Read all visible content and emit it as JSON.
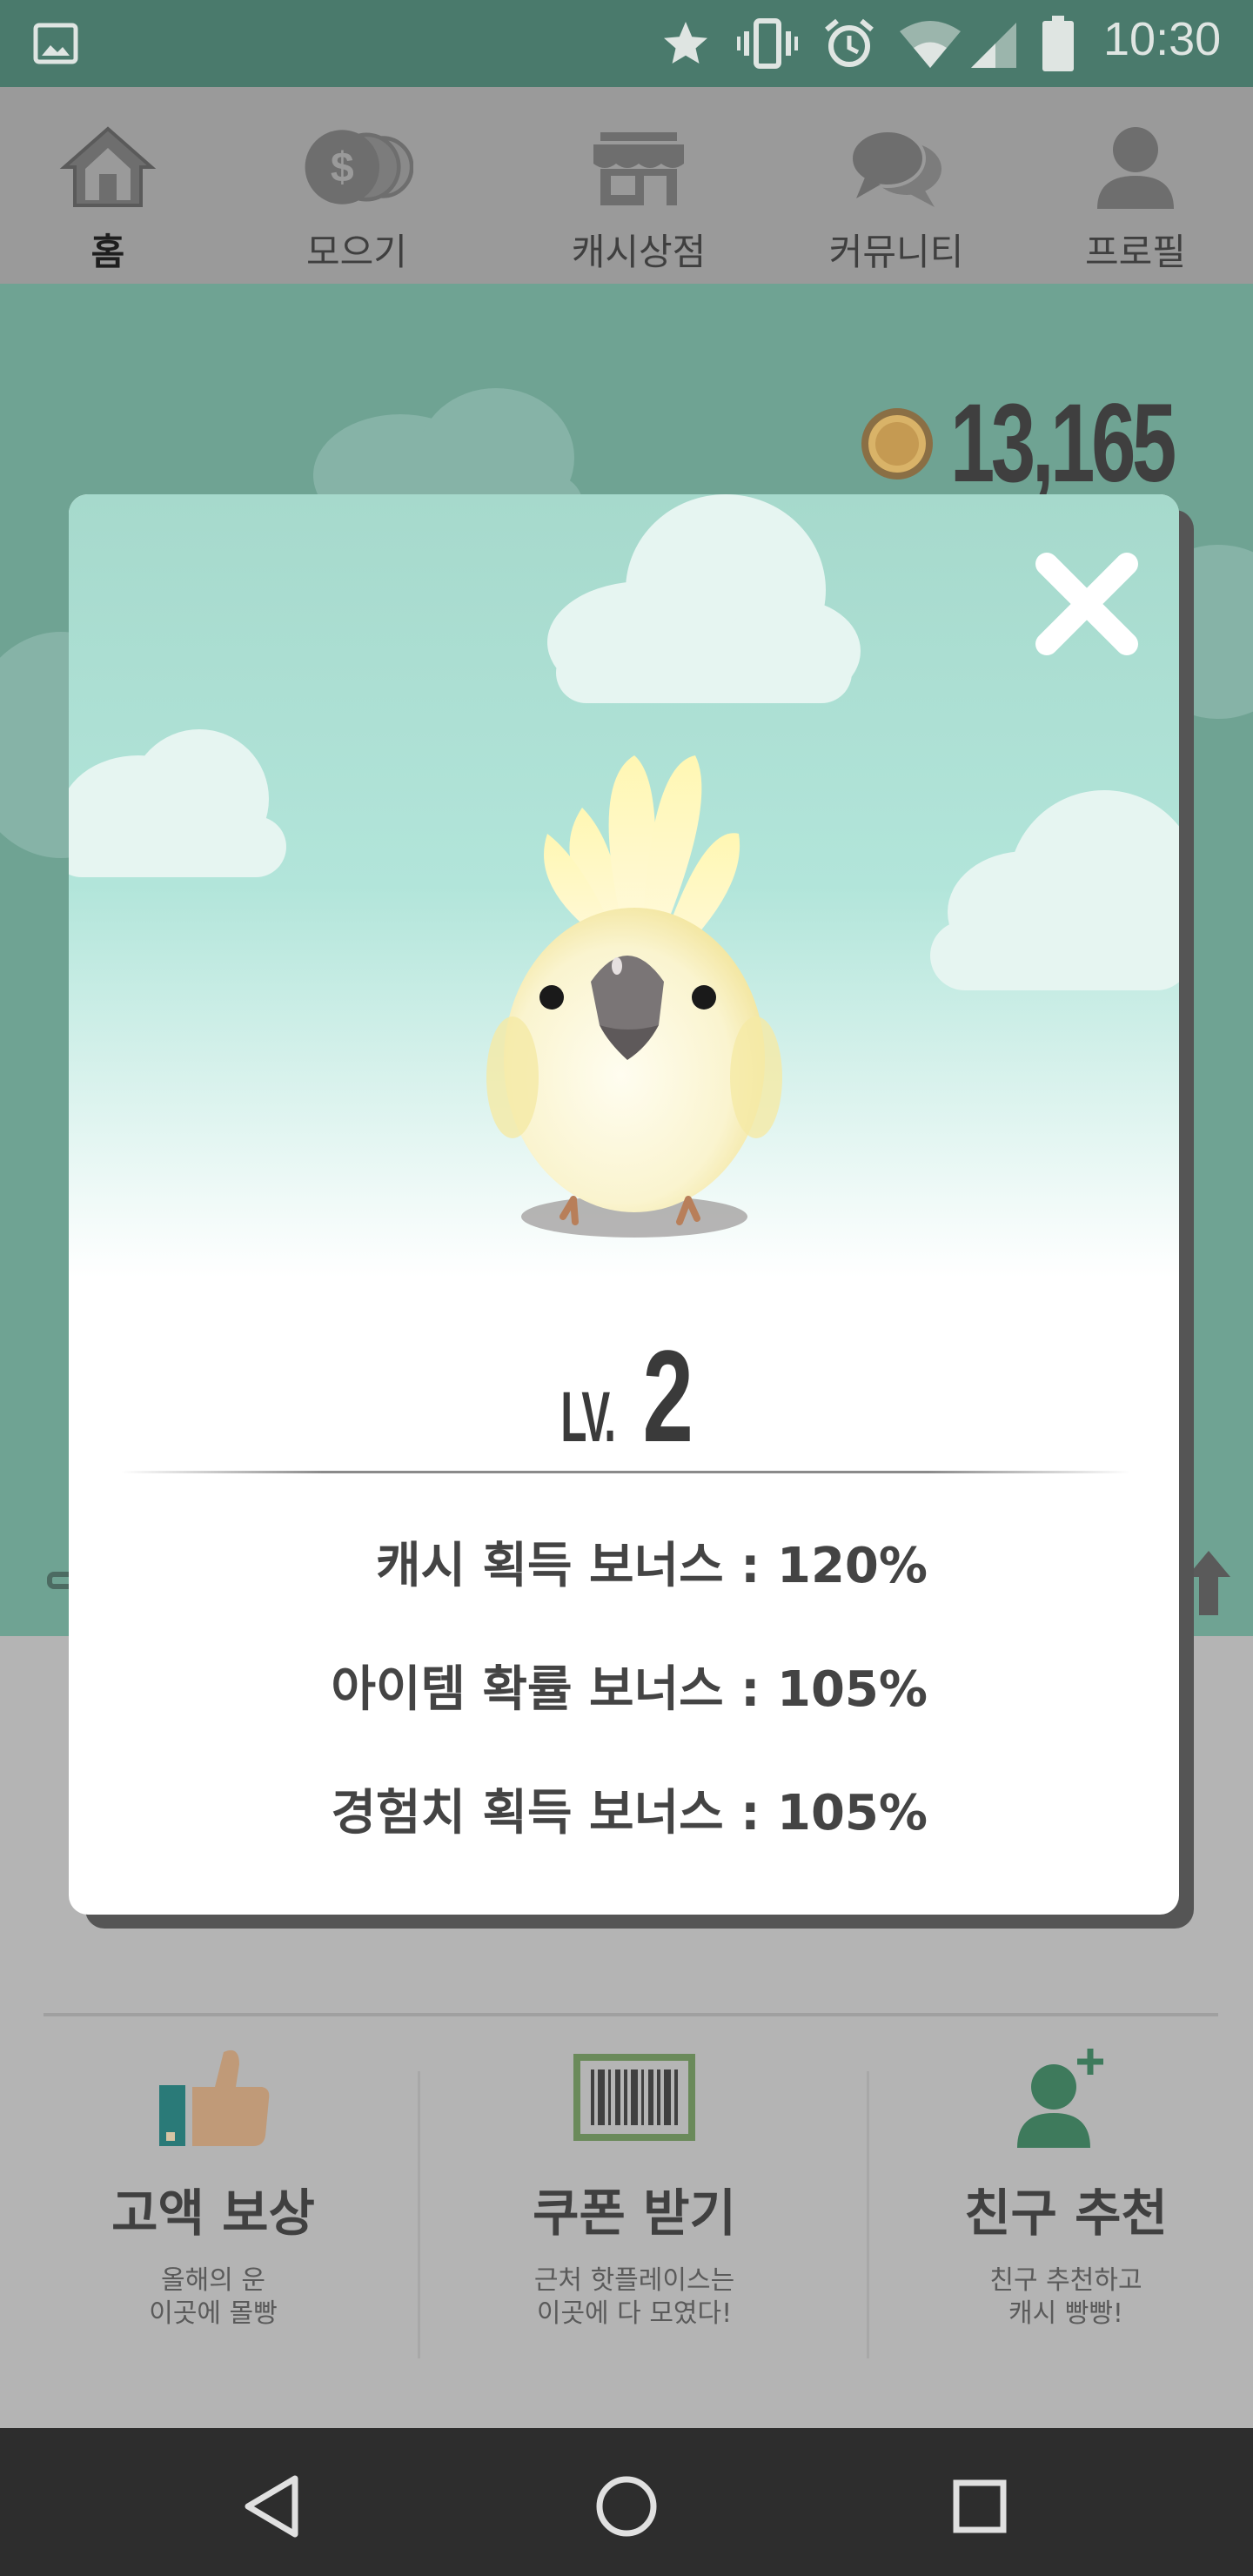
{
  "status_bar": {
    "time": "10:30",
    "icons": [
      "image-icon",
      "star-icon",
      "vibrate-icon",
      "alarm-icon",
      "wifi-icon",
      "signal-icon",
      "battery-icon"
    ]
  },
  "top_nav": {
    "items": [
      {
        "label": "홈",
        "icon": "home-icon",
        "active": true
      },
      {
        "label": "모으기",
        "icon": "coins-icon",
        "active": false
      },
      {
        "label": "캐시상점",
        "icon": "store-icon",
        "active": false
      },
      {
        "label": "커뮤니티",
        "icon": "chat-icon",
        "active": false
      },
      {
        "label": "프로필",
        "icon": "person-icon",
        "active": false
      }
    ]
  },
  "balance": {
    "amount": "13,165",
    "icon": "coin-icon"
  },
  "modal": {
    "level_prefix": "LV.",
    "level_number": "2",
    "close_icon": "close-icon",
    "character_icon": "cockatoo-icon",
    "stats": [
      "캐시 획득 보너스 : 120%",
      "아이템 확률 보너스 : 105%",
      "경험치 획득 보너스 : 105%"
    ]
  },
  "features": [
    {
      "title": "고액 보상",
      "subtitle_line1": "올해의 운",
      "subtitle_line2": "이곳에 몰빵",
      "icon": "thumbs-up-icon"
    },
    {
      "title": "쿠폰 받기",
      "subtitle_line1": "근처 핫플레이스는",
      "subtitle_line2": "이곳에 다 모였다!",
      "icon": "barcode-icon"
    },
    {
      "title": "친구 추천",
      "subtitle_line1": "친구 추천하고",
      "subtitle_line2": "캐시 빵빵!",
      "icon": "add-friend-icon"
    }
  ],
  "nav_bar": {
    "icons": [
      "back-icon",
      "home-circle-icon",
      "recents-icon"
    ]
  },
  "colors": {
    "status_bar": "#4a7a6c",
    "scene_dim": "#6fa393",
    "modal_sky_top": "#a6d9cc",
    "nav_bar": "#2d2d2d"
  }
}
